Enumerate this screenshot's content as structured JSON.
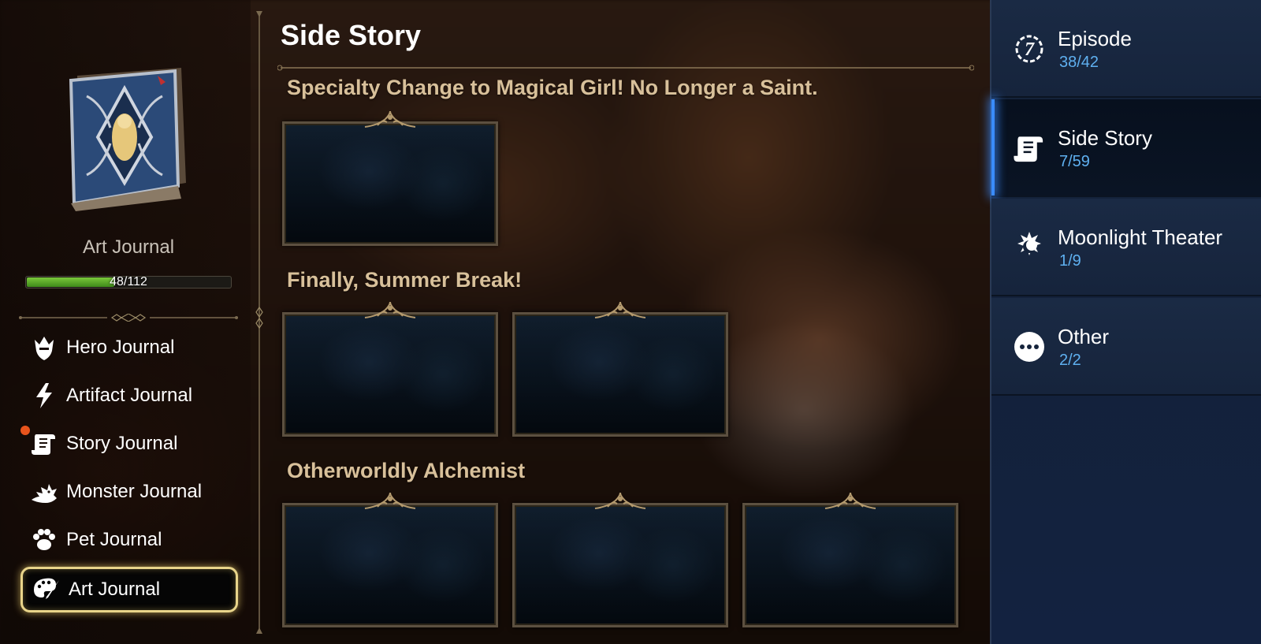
{
  "left_panel": {
    "journal_title": "Art Journal",
    "progress": {
      "current": 48,
      "total": 112,
      "text": "48/112",
      "fraction": 0.4286
    },
    "nav_items": [
      {
        "label": "Hero Journal",
        "icon": "hero-helmet-icon",
        "active": false,
        "badge": false
      },
      {
        "label": "Artifact Journal",
        "icon": "lightning-icon",
        "active": false,
        "badge": false
      },
      {
        "label": "Story Journal",
        "icon": "scroll-icon",
        "active": false,
        "badge": true
      },
      {
        "label": "Monster Journal",
        "icon": "dragon-icon",
        "active": false,
        "badge": false
      },
      {
        "label": "Pet Journal",
        "icon": "paw-icon",
        "active": false,
        "badge": false
      },
      {
        "label": "Art Journal",
        "icon": "palette-icon",
        "active": true,
        "badge": false
      }
    ]
  },
  "main": {
    "title": "Side Story",
    "groups": [
      {
        "title": "Specialty Change to Magical Girl! No Longer a Saint.",
        "count": 1
      },
      {
        "title": "Finally, Summer Break!",
        "count": 2
      },
      {
        "title": "Otherworldly Alchemist",
        "count": 3
      }
    ]
  },
  "right_panel": {
    "categories": [
      {
        "label": "Episode",
        "count": "38/42",
        "icon": "seven-emblem-icon",
        "active": false
      },
      {
        "label": "Side Story",
        "count": "7/59",
        "icon": "scroll-icon",
        "active": true
      },
      {
        "label": "Moonlight Theater",
        "count": "1/9",
        "icon": "moon-sun-icon",
        "active": false
      },
      {
        "label": "Other",
        "count": "2/2",
        "icon": "more-dots-icon",
        "active": false
      }
    ]
  },
  "colors": {
    "accent_blue": "#3a8cff",
    "count_blue": "#5fb0f0",
    "gold": "#e8d48a",
    "progress_green": "#7ac83a",
    "badge_orange": "#e8541c",
    "group_title": "#d8c09a"
  }
}
